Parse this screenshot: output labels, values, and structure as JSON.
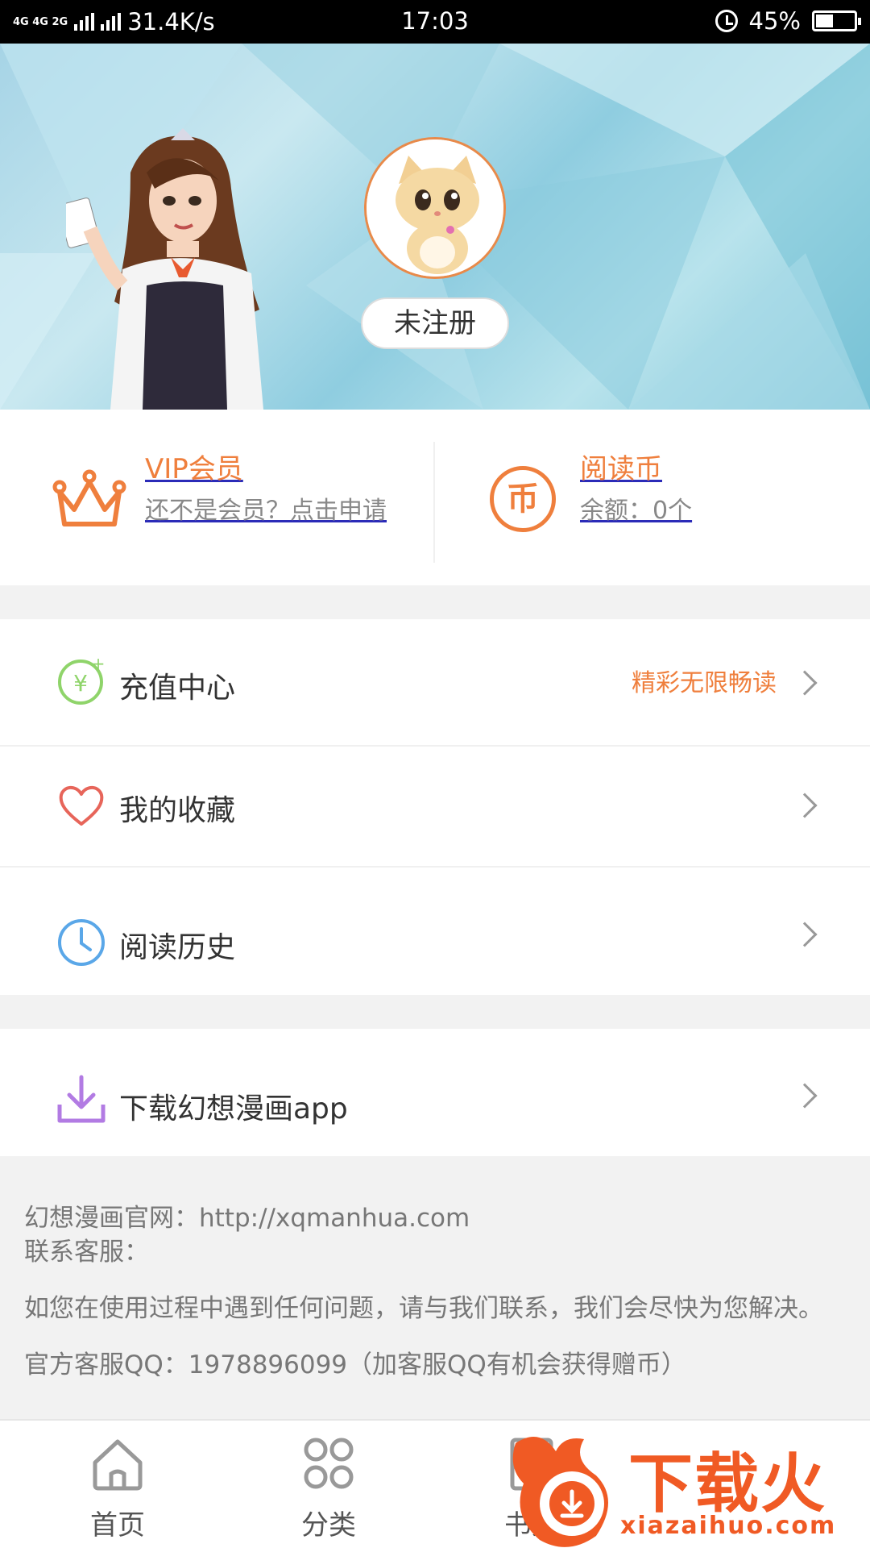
{
  "status_bar": {
    "network_label": "4G 4G 2G",
    "speed": "31.4K/s",
    "time": "17:03",
    "battery": "45%",
    "battery_level": 0.45
  },
  "profile": {
    "register_label": "未注册"
  },
  "vip": {
    "title": "VIP会员",
    "subtitle": "还不是会员？点击申请"
  },
  "coins": {
    "icon_glyph": "币",
    "title": "阅读币",
    "balance": "余额：0个"
  },
  "menu": {
    "recharge": {
      "label": "充值中心",
      "extra": "精彩无限畅读"
    },
    "favorites": {
      "label": "我的收藏"
    },
    "history": {
      "label": "阅读历史"
    },
    "download": {
      "label": "下载幻想漫画app"
    }
  },
  "info": {
    "website": "幻想漫画官网：http://xqmanhua.com",
    "service": "联系客服：",
    "notice": "如您在使用过程中遇到任何问题，请与我们联系，我们会尽快为您解决。",
    "qq": "官方客服QQ：1978896099（加客服QQ有机会获得赠币）"
  },
  "bottom_nav": {
    "home": "首页",
    "category": "分类",
    "bookshelf": "书架"
  },
  "watermark": {
    "brand": "下载火",
    "url": "xiazaihuo.com"
  },
  "colors": {
    "accent": "#ef7f3d",
    "link_underline": "#2b2bb8",
    "watermark": "#f05a24"
  }
}
